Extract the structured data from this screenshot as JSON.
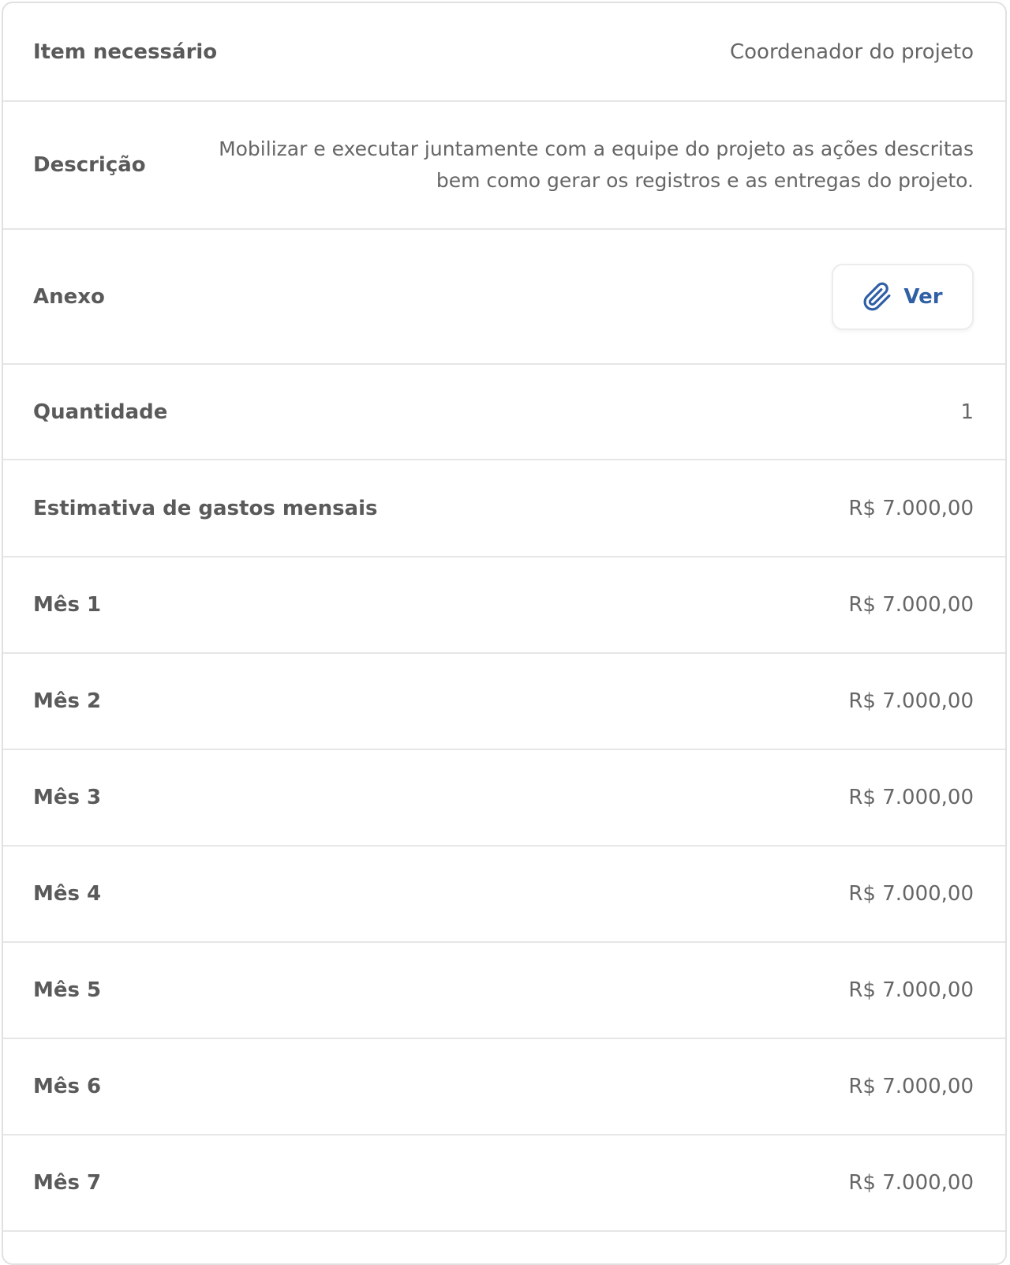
{
  "details": {
    "item": {
      "label": "Item necessário",
      "value": "Coordenador do projeto"
    },
    "description": {
      "label": "Descrição",
      "value": "Mobilizar e executar juntamente com a equipe do projeto as ações descritas bem como gerar os registros e as entregas do projeto."
    },
    "attachment": {
      "label": "Anexo",
      "button_label": "Ver",
      "icon": "paperclip-icon",
      "accent_color": "#2f5fa5"
    },
    "quantity": {
      "label": "Quantidade",
      "value": "1"
    },
    "monthly_estimate": {
      "label": "Estimativa de gastos mensais",
      "value": "R$ 7.000,00"
    },
    "months": [
      {
        "label": "Mês 1",
        "value": "R$ 7.000,00"
      },
      {
        "label": "Mês 2",
        "value": "R$ 7.000,00"
      },
      {
        "label": "Mês 3",
        "value": "R$ 7.000,00"
      },
      {
        "label": "Mês 4",
        "value": "R$ 7.000,00"
      },
      {
        "label": "Mês 5",
        "value": "R$ 7.000,00"
      },
      {
        "label": "Mês 6",
        "value": "R$ 7.000,00"
      },
      {
        "label": "Mês 7",
        "value": "R$ 7.000,00"
      }
    ]
  }
}
